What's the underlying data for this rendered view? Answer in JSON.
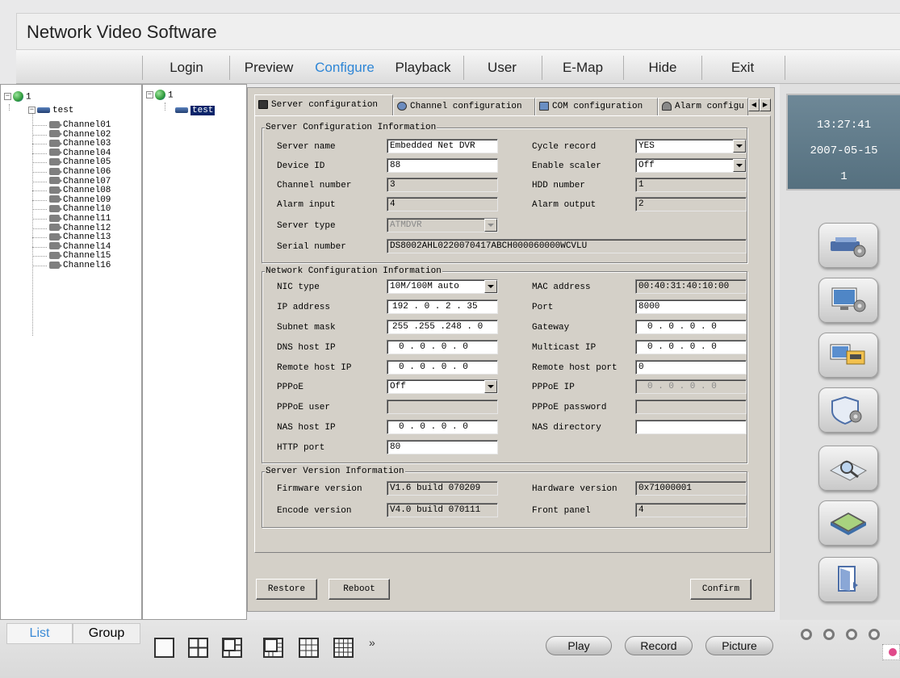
{
  "app": {
    "title": "Network Video Software"
  },
  "menu": [
    "Login",
    "Preview",
    "Configure",
    "Playback",
    "User",
    "E-Map",
    "Hide",
    "Exit"
  ],
  "menu_active": "Configure",
  "tree_left": {
    "root": "1",
    "server": "test",
    "channels": [
      "Channel01",
      "Channel02",
      "Channel03",
      "Channel04",
      "Channel05",
      "Channel06",
      "Channel07",
      "Channel08",
      "Channel09",
      "Channel10",
      "Channel11",
      "Channel12",
      "Channel13",
      "Channel14",
      "Channel15",
      "Channel16"
    ]
  },
  "tree_right": {
    "root": "1",
    "server": "test"
  },
  "tabs": [
    "Server configuration",
    "Channel configuration",
    "COM configuration",
    "Alarm configu"
  ],
  "tab_icons": [
    "monitor-icon",
    "gear-icon",
    "com-port-icon",
    "bell-icon"
  ],
  "server_info": {
    "title": "Server Configuration Information",
    "server_name_label": "Server name",
    "server_name": "Embedded Net DVR",
    "cycle_record_label": "Cycle record",
    "cycle_record": "YES",
    "device_id_label": "Device ID",
    "device_id": "88",
    "enable_scaler_label": "Enable scaler",
    "enable_scaler": "Off",
    "channel_number_label": "Channel number",
    "channel_number": "3",
    "hdd_number_label": "HDD number",
    "hdd_number": "1",
    "alarm_input_label": "Alarm input",
    "alarm_input": "4",
    "alarm_output_label": "Alarm output",
    "alarm_output": "2",
    "server_type_label": "Server type",
    "server_type": "ATMDVR",
    "serial_number_label": "Serial number",
    "serial_number": "DS8002AHL0220070417ABCH000060000WCVLU"
  },
  "network_info": {
    "title": "Network Configuration Information",
    "nic_type_label": "NIC type",
    "nic_type": "10M/100M auto",
    "mac_address_label": "MAC address",
    "mac_address": "00:40:31:40:10:00",
    "ip_address_label": "IP address",
    "ip_address": "192 . 0  . 2  . 35",
    "port_label": "Port",
    "port": "8000",
    "subnet_mask_label": "Subnet mask",
    "subnet_mask": "255 .255 .248 . 0",
    "gateway_label": "Gateway",
    "gateway": "0  . 0  . 0  . 0",
    "dns_host_ip_label": "DNS host IP",
    "dns_host_ip": "0  . 0  . 0  . 0",
    "multicast_ip_label": "Multicast IP",
    "multicast_ip": "0  . 0  . 0  . 0",
    "remote_host_ip_label": "Remote host IP",
    "remote_host_ip": "0  . 0  . 0  . 0",
    "remote_host_port_label": "Remote host port",
    "remote_host_port": "0",
    "pppoe_label": "PPPoE",
    "pppoe": "Off",
    "pppoe_ip_label": "PPPoE IP",
    "pppoe_ip": "0  . 0  . 0  . 0",
    "pppoe_user_label": "PPPoE user",
    "pppoe_user": "",
    "pppoe_password_label": "PPPoE password",
    "pppoe_password": "",
    "nas_host_ip_label": "NAS host IP",
    "nas_host_ip": "0  . 0  . 0  . 0",
    "nas_directory_label": "NAS directory",
    "nas_directory": "",
    "http_port_label": "HTTP port",
    "http_port": "80"
  },
  "version_info": {
    "title": "Server Version Information",
    "firmware_version_label": "Firmware version",
    "firmware_version": "V1.6 build 070209",
    "hardware_version_label": "Hardware version",
    "hardware_version": "0x71000001",
    "encode_version_label": "Encode version",
    "encode_version": "V4.0 build 070111",
    "front_panel_label": "Front panel",
    "front_panel": "4"
  },
  "buttons": {
    "restore": "Restore",
    "reboot": "Reboot",
    "confirm": "Confirm"
  },
  "clock": {
    "time": "13:27:41",
    "date": "2007-05-15",
    "index": "1"
  },
  "side_buttons": [
    "dvr-settings-icon",
    "monitor-settings-icon",
    "channel-config-icon",
    "security-settings-icon",
    "search-icon",
    "log-icon",
    "exit-door-icon"
  ],
  "bottom": {
    "tabs": [
      "List",
      "Group"
    ],
    "active_tab": "List",
    "more": "»",
    "play": "Play",
    "record": "Record",
    "picture": "Picture"
  },
  "colors": {
    "accent": "#2e86d6",
    "clock_bg": "#5f7b8a",
    "selection": "#0a246a"
  }
}
